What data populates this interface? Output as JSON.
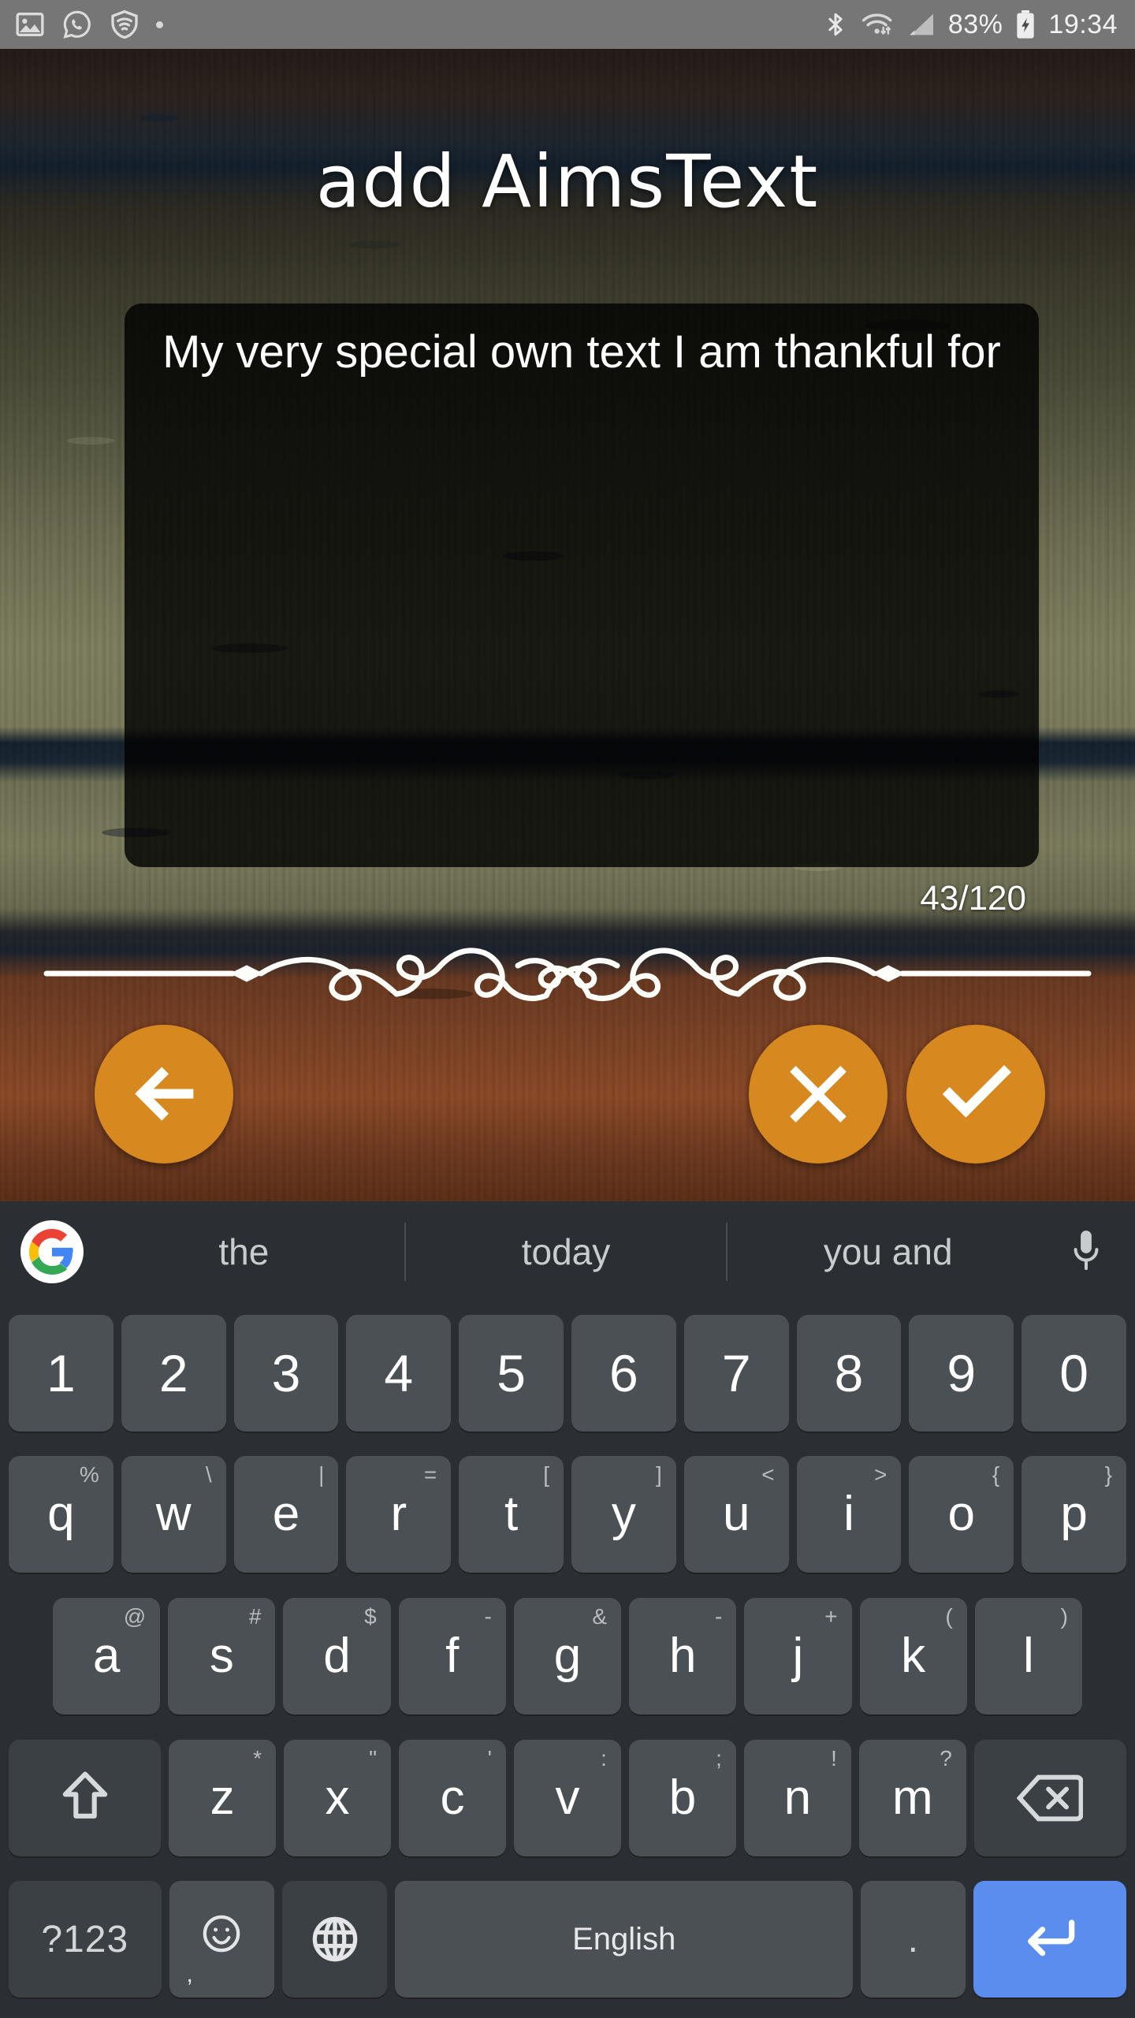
{
  "statusbar": {
    "left_icons": [
      "photo-icon",
      "whatsapp-icon",
      "wifi-shield-icon",
      "dot-indicator"
    ],
    "right_icons": [
      "bluetooth-icon",
      "wifi-icon",
      "signal-icon",
      "battery-charging-icon"
    ],
    "battery_percent": "83%",
    "time": "19:34"
  },
  "app": {
    "title": "add AimsText",
    "accent_color": "#d7881f",
    "textbox": {
      "value": "My very special own text I am thankful for",
      "placeholder": "",
      "counter": "43/120",
      "char_count": 43,
      "char_limit": 120
    },
    "ornament_label": "decorative-flourish-divider",
    "buttons": [
      {
        "name": "back",
        "icon": "arrow-left-icon",
        "label": ""
      },
      {
        "name": "cancel",
        "icon": "close-x-icon",
        "label": ""
      },
      {
        "name": "confirm",
        "icon": "check-icon",
        "label": ""
      }
    ]
  },
  "keyboard": {
    "logo": "google-g-icon",
    "mic": "microphone-icon",
    "suggestions": [
      "the",
      "today",
      "you and"
    ],
    "rows": {
      "numbers": [
        {
          "main": "1"
        },
        {
          "main": "2"
        },
        {
          "main": "3"
        },
        {
          "main": "4"
        },
        {
          "main": "5"
        },
        {
          "main": "6"
        },
        {
          "main": "7"
        },
        {
          "main": "8"
        },
        {
          "main": "9"
        },
        {
          "main": "0"
        }
      ],
      "top": [
        {
          "main": "q",
          "sup": "%"
        },
        {
          "main": "w",
          "sup": "\\"
        },
        {
          "main": "e",
          "sup": "|"
        },
        {
          "main": "r",
          "sup": "="
        },
        {
          "main": "t",
          "sup": "["
        },
        {
          "main": "y",
          "sup": "]"
        },
        {
          "main": "u",
          "sup": "<"
        },
        {
          "main": "i",
          "sup": ">"
        },
        {
          "main": "o",
          "sup": "{"
        },
        {
          "main": "p",
          "sup": "}"
        }
      ],
      "home": [
        {
          "main": "a",
          "sup": "@"
        },
        {
          "main": "s",
          "sup": "#"
        },
        {
          "main": "d",
          "sup": "$"
        },
        {
          "main": "f",
          "sup": "-"
        },
        {
          "main": "g",
          "sup": "&"
        },
        {
          "main": "h",
          "sup": "-"
        },
        {
          "main": "j",
          "sup": "+"
        },
        {
          "main": "k",
          "sup": "("
        },
        {
          "main": "l",
          "sup": ")"
        }
      ],
      "bottom": [
        {
          "main": "z",
          "sup": "*"
        },
        {
          "main": "x",
          "sup": "\""
        },
        {
          "main": "c",
          "sup": "'"
        },
        {
          "main": "v",
          "sup": ":"
        },
        {
          "main": "b",
          "sup": ";"
        },
        {
          "main": "n",
          "sup": "!"
        },
        {
          "main": "m",
          "sup": "?"
        }
      ]
    },
    "shift_key": "shift-icon",
    "backspace_key": "backspace-icon",
    "symbols_key": "?123",
    "emoji_key": "emoji-icon",
    "emoji_sub": ",",
    "globe_key": "globe-icon",
    "space_key": "English",
    "period_key": ".",
    "enter_key": "enter-icon",
    "enter_color": "#5b8dee"
  }
}
